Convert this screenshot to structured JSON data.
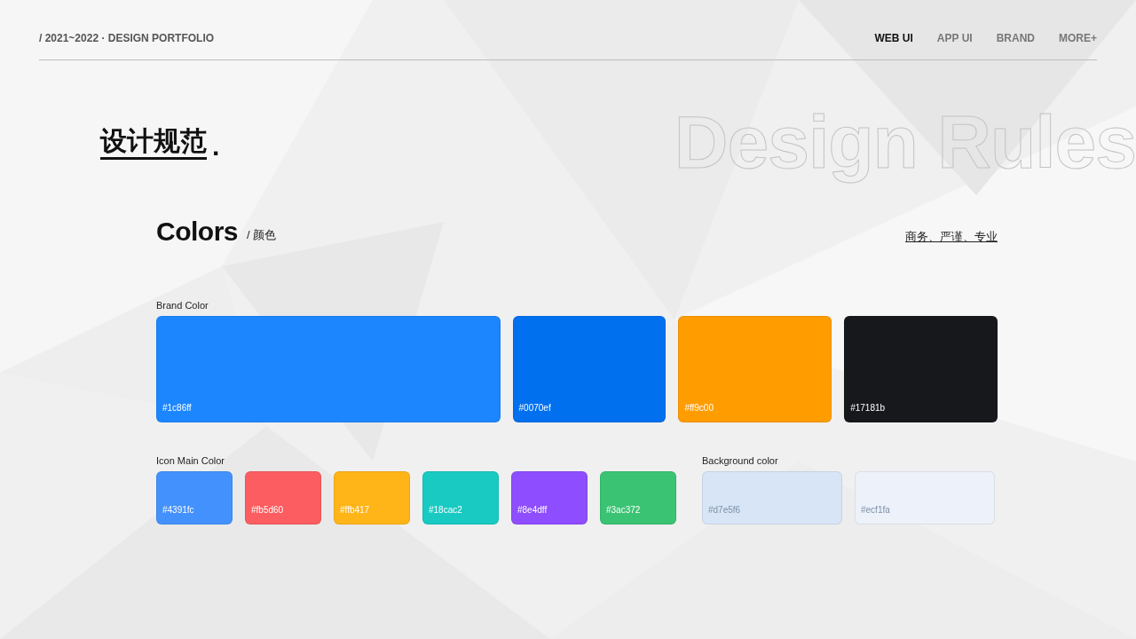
{
  "header": {
    "title": "/ 2021~2022 · DESIGN PORTFOLIO",
    "nav": [
      {
        "label": "WEB UI",
        "selected": true
      },
      {
        "label": "APP UI",
        "selected": false
      },
      {
        "label": "BRAND",
        "selected": false
      },
      {
        "label": "MORE+",
        "selected": false
      }
    ]
  },
  "heading": {
    "title": "设计规范",
    "dot": ".",
    "outline_text": "Design Rules"
  },
  "section": {
    "title": "Colors",
    "subtitle": "/ 颜色",
    "tagline": "商务、严谨、专业"
  },
  "brand_colors": {
    "label": "Brand Color",
    "swatches": [
      {
        "hex": "#1c86ff",
        "color": "#1c86ff"
      },
      {
        "hex": "#0070ef",
        "color": "#0070ef"
      },
      {
        "hex": "#ff9c00",
        "color": "#ff9c00"
      },
      {
        "hex": "#17181b",
        "color": "#17181b"
      }
    ]
  },
  "icon_colors": {
    "label": "Icon Main Color",
    "swatches": [
      {
        "hex": "#4391fc",
        "color": "#4391fc"
      },
      {
        "hex": "#fb5d60",
        "color": "#fb5d60"
      },
      {
        "hex": "#ffb417",
        "color": "#ffb417"
      },
      {
        "hex": "#18cac2",
        "color": "#18cac2"
      },
      {
        "hex": "#8e4dff",
        "color": "#8e4dff"
      },
      {
        "hex": "#3ac372",
        "color": "#3ac372"
      }
    ]
  },
  "background_colors": {
    "label": "Background color",
    "swatches": [
      {
        "hex": "#d7e5f6",
        "color": "#d7e5f6"
      },
      {
        "hex": "#ecf1fa",
        "color": "#ecf1fa"
      }
    ]
  }
}
